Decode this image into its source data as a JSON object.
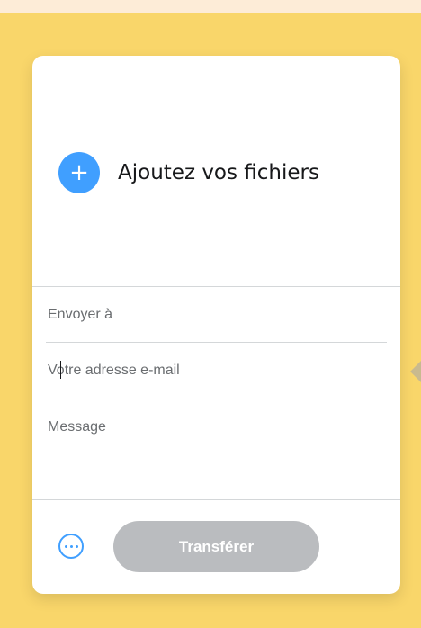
{
  "upload": {
    "add_icon": "plus-icon",
    "label": "Ajoutez vos fichiers"
  },
  "form": {
    "recipient_placeholder": "Envoyer à",
    "recipient_value": "",
    "sender_placeholder": "Votre adresse e-mail",
    "sender_value": "",
    "message_placeholder": "Message",
    "message_value": ""
  },
  "footer": {
    "options_icon": "more-options-icon",
    "transfer_label": "Transférer",
    "transfer_enabled": false
  },
  "colors": {
    "page_background": "#f9d66a",
    "top_strip": "#fdecd7",
    "accent": "#409fff",
    "button_disabled": "#babcbf",
    "divider": "#d4d7d9",
    "text": "#17181a",
    "placeholder": "#6a6d70"
  }
}
